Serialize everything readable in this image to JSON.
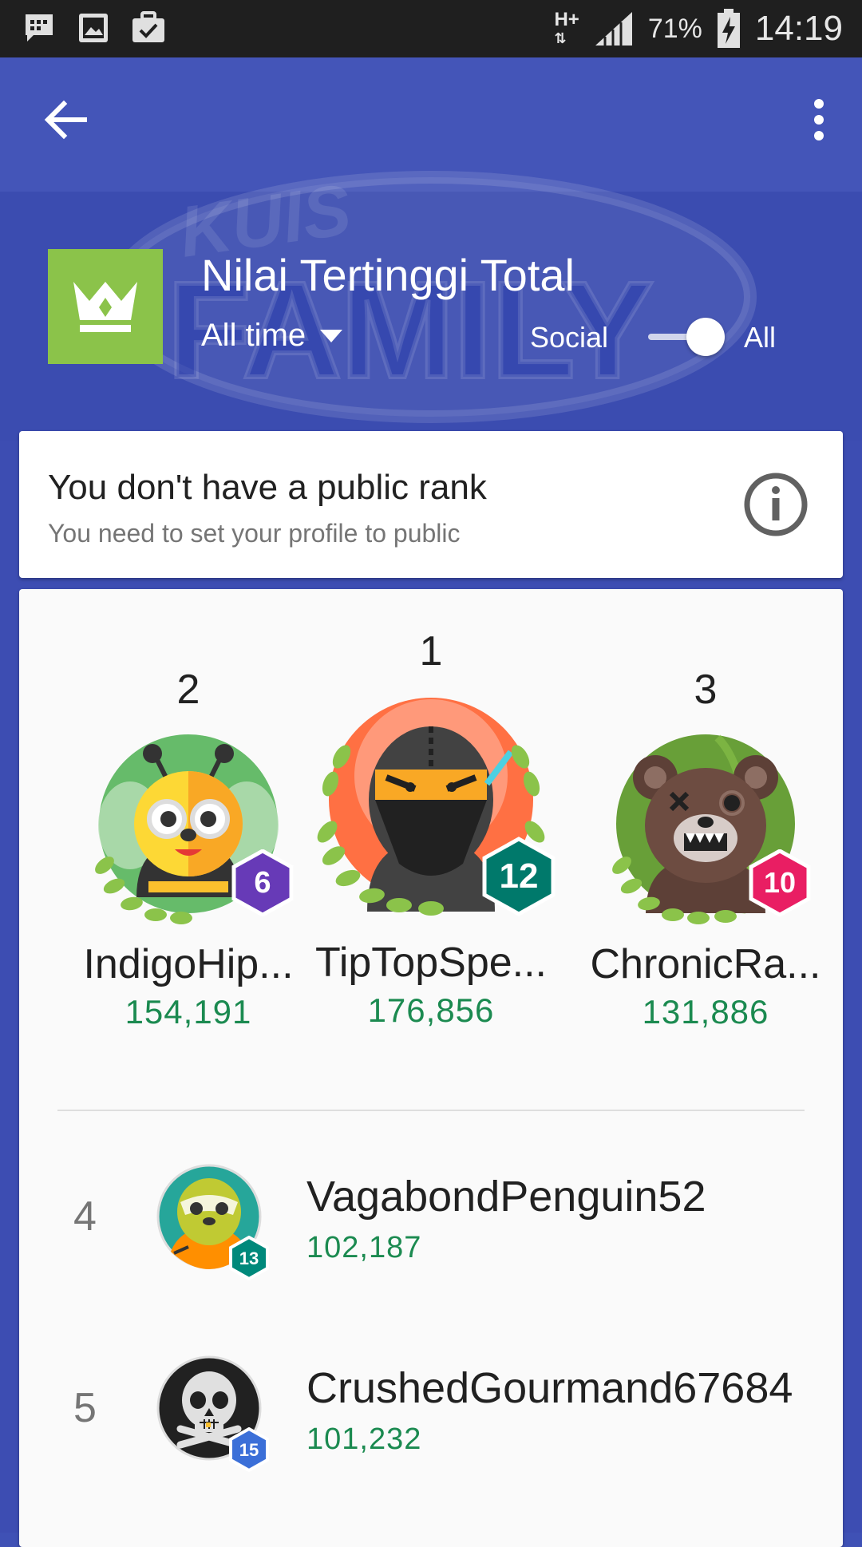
{
  "status_bar": {
    "network": "H+",
    "battery": "71%",
    "time": "14:19",
    "icons": [
      "chat-icon",
      "image-icon",
      "briefcase-check-icon",
      "signal-icon",
      "battery-charging-icon"
    ]
  },
  "toolbar": {
    "back_icon": "arrow-back-icon",
    "menu_icon": "more-vert-icon"
  },
  "header": {
    "title": "Nilai Tertinggi Total",
    "time_filter": "All time",
    "toggle_left": "Social",
    "toggle_right": "All",
    "toggle_state": "All",
    "crown_color": "#8bc34a",
    "background_watermark": [
      "KUIS",
      "FAMILY"
    ]
  },
  "rank_notice": {
    "title": "You don't have a public rank",
    "subtitle": "You need to set your profile to public"
  },
  "podium": [
    {
      "rank": "2",
      "name": "IndigoHip...",
      "score": "154,191",
      "level": "6",
      "badge_color": "#673ab7",
      "avatar": "bee-avatar"
    },
    {
      "rank": "1",
      "name": "TipTopSpe...",
      "score": "176,856",
      "level": "12",
      "badge_color": "#00796b",
      "avatar": "ninja-avatar"
    },
    {
      "rank": "3",
      "name": "ChronicRa...",
      "score": "131,886",
      "level": "10",
      "badge_color": "#e91e63",
      "avatar": "bear-avatar"
    }
  ],
  "list": [
    {
      "rank": "4",
      "name": "VagabondPenguin52",
      "score": "102,187",
      "level": "13",
      "badge_color": "#00897b",
      "avatar": "sloth-avatar"
    },
    {
      "rank": "5",
      "name": "CrushedGourmand67684",
      "score": "101,232",
      "level": "15",
      "badge_color": "#3b6fd8",
      "avatar": "skull-avatar"
    }
  ],
  "colors": {
    "primary": "#3f51b5",
    "score_green": "#1b8a50"
  }
}
